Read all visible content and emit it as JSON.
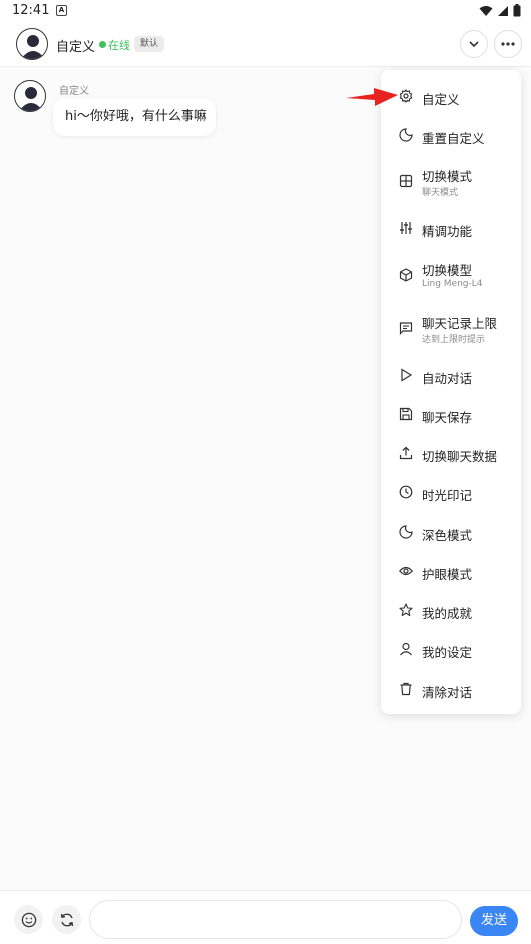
{
  "status_bar": {
    "time": "12:41",
    "notif_glyph": "A"
  },
  "header": {
    "name": "自定义",
    "online": "在线",
    "badge": "默认",
    "online_color": "#3ec15a"
  },
  "chat": {
    "sender": "自定义",
    "message": "hi～你好哦，有什么事嘛"
  },
  "menu": {
    "items": [
      {
        "label": "自定义",
        "icon": "settings-icon"
      },
      {
        "label": "重置自定义",
        "icon": "reset-icon"
      },
      {
        "label": "切换模式",
        "sub": "聊天模式",
        "icon": "grid-icon"
      },
      {
        "label": "精调功能",
        "icon": "sliders-icon"
      },
      {
        "label": "切换模型",
        "sub": "Ling Meng-L4",
        "icon": "cube-icon"
      },
      {
        "label": "聊天记录上限",
        "sub": "达到上限时提示",
        "icon": "message-icon"
      },
      {
        "label": "自动对话",
        "icon": "play-icon"
      },
      {
        "label": "聊天保存",
        "icon": "save-icon"
      },
      {
        "label": "切换聊天数据",
        "icon": "upload-icon"
      },
      {
        "label": "时光印记",
        "icon": "clock-icon"
      },
      {
        "label": "深色模式",
        "icon": "moon-icon"
      },
      {
        "label": "护眼模式",
        "icon": "eye-icon"
      },
      {
        "label": "我的成就",
        "icon": "star-icon"
      },
      {
        "label": "我的设定",
        "icon": "user-icon"
      },
      {
        "label": "清除对话",
        "icon": "trash-icon"
      }
    ]
  },
  "composer": {
    "input_value": "",
    "send_label": "发送",
    "send_color": "#3a86f5"
  },
  "annotation": {
    "arrow_color": "#e8231f"
  }
}
